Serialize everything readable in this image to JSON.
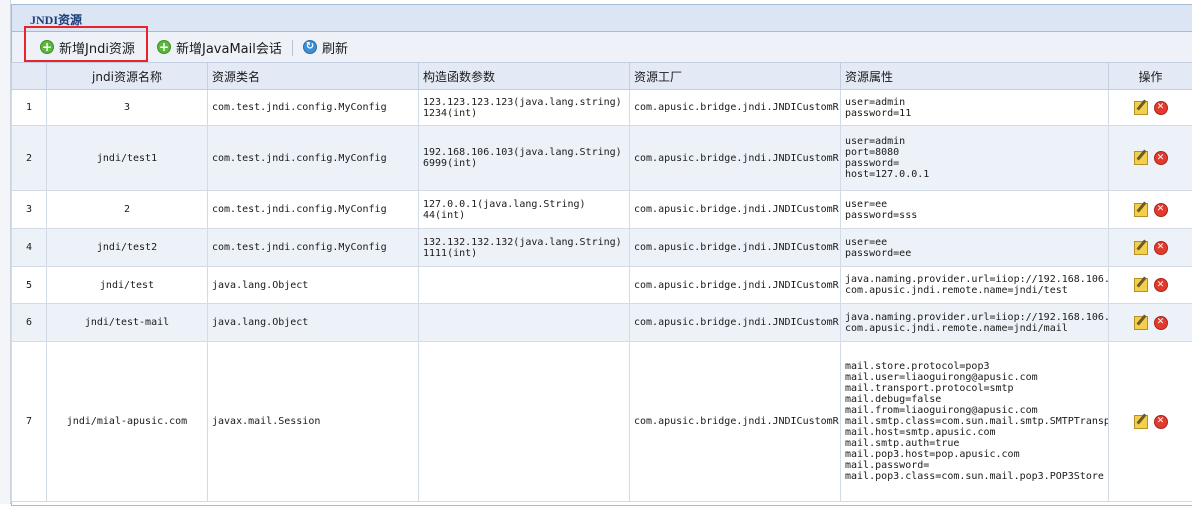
{
  "panel": {
    "title": "JNDI资源"
  },
  "toolbar": {
    "add_jndi_label": "新增Jndi资源",
    "add_javamail_label": "新增JavaMail会话",
    "refresh_label": "刷新"
  },
  "table": {
    "columns": [
      "",
      "jndi资源名称",
      "资源类名",
      "构造函数参数",
      "资源工厂",
      "资源属性",
      "操作"
    ],
    "rows": [
      {
        "no": "1",
        "name": "3",
        "class": "com.test.jndi.config.MyConfig",
        "args": [
          "123.123.123.123(java.lang.string)",
          "1234(int)"
        ],
        "factory": "com.apusic.bridge.jndi.JNDICustomR",
        "props": [
          "user=admin",
          "password=11"
        ]
      },
      {
        "no": "2",
        "name": "jndi/test1",
        "class": "com.test.jndi.config.MyConfig",
        "args": [
          "192.168.106.103(java.lang.String)",
          "6999(int)"
        ],
        "factory": "com.apusic.bridge.jndi.JNDICustomR",
        "props": [
          "user=admin",
          "port=8080",
          "password=",
          "host=127.0.0.1"
        ]
      },
      {
        "no": "3",
        "name": "2",
        "class": "com.test.jndi.config.MyConfig",
        "args": [
          "127.0.0.1(java.lang.String)",
          "44(int)"
        ],
        "factory": "com.apusic.bridge.jndi.JNDICustomR",
        "props": [
          "user=ee",
          "password=sss"
        ]
      },
      {
        "no": "4",
        "name": "jndi/test2",
        "class": "com.test.jndi.config.MyConfig",
        "args": [
          "132.132.132.132(java.lang.String)",
          "1111(int)"
        ],
        "factory": "com.apusic.bridge.jndi.JNDICustomR",
        "props": [
          "user=ee",
          "password=ee"
        ]
      },
      {
        "no": "5",
        "name": "jndi/test",
        "class": "java.lang.Object",
        "args": [],
        "factory": "com.apusic.bridge.jndi.JNDICustomR",
        "props": [
          "java.naming.provider.url=iiop://192.168.106.",
          "com.apusic.jndi.remote.name=jndi/test"
        ]
      },
      {
        "no": "6",
        "name": "jndi/test-mail",
        "class": "java.lang.Object",
        "args": [],
        "factory": "com.apusic.bridge.jndi.JNDICustomR",
        "props": [
          "java.naming.provider.url=iiop://192.168.106.",
          "com.apusic.jndi.remote.name=jndi/mail"
        ]
      },
      {
        "no": "7",
        "name": "jndi/mial-apusic.com",
        "class": "javax.mail.Session",
        "args": [],
        "factory": "com.apusic.bridge.jndi.JNDICustomR",
        "props": [
          "mail.store.protocol=pop3",
          "mail.user=liaoguirong@apusic.com",
          "mail.transport.protocol=smtp",
          "mail.debug=false",
          "mail.from=liaoguirong@apusic.com",
          "mail.smtp.class=com.sun.mail.smtp.SMTPTransp",
          "mail.host=smtp.apusic.com",
          "mail.smtp.auth=true",
          "mail.pop3.host=pop.apusic.com",
          "mail.password=",
          "mail.pop3.class=com.sun.mail.pop3.POP3Store"
        ]
      }
    ]
  },
  "icons": {
    "add": "add-circle-icon",
    "refresh": "refresh-icon",
    "edit": "edit-icon",
    "delete": "delete-icon"
  }
}
